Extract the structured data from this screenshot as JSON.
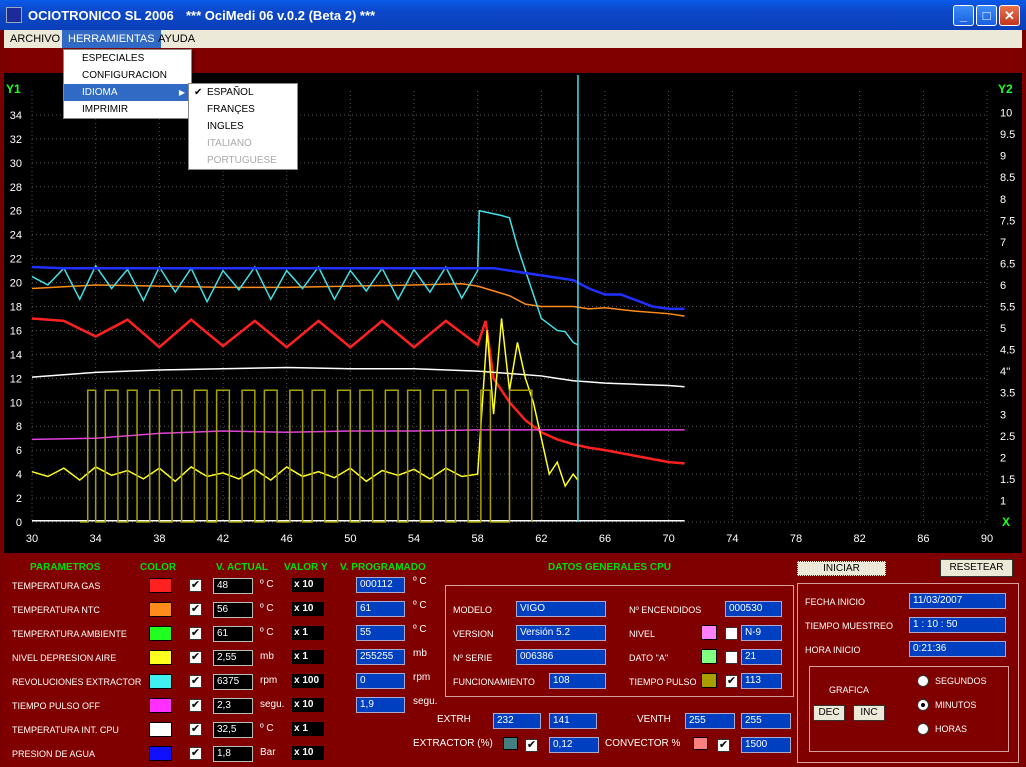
{
  "window": {
    "app_name": "OCIOTRONICO SL 2006",
    "title": "*** OciMedi 06  v.0.2 (Beta 2) ***",
    "minimize": "_",
    "maximize": "□",
    "close": "✕"
  },
  "menubar": [
    "ARCHIVO",
    "HERRAMIENTAS",
    "AYUDA"
  ],
  "herramientas_menu": [
    "ESPECIALES",
    "CONFIGURACION",
    "IDIOMA",
    "IMPRIMIR"
  ],
  "idioma_menu": {
    "items": [
      "ESPAÑOL",
      "FRANÇES",
      "INGLES",
      "ITALIANO",
      "PORTUGUESE"
    ],
    "selected": "ESPAÑOL",
    "disabled": [
      "ITALIANO",
      "PORTUGUESE"
    ]
  },
  "chart_data": {
    "type": "line",
    "y1_label": "Y1",
    "y2_label": "Y2",
    "x_label": "X",
    "xlim": [
      30,
      90
    ],
    "y1lim": [
      0,
      36
    ],
    "y2lim": [
      0.5,
      10.5
    ],
    "x_ticks": [
      "30",
      "34",
      "38",
      "42",
      "46",
      "50",
      "54",
      "58",
      "62",
      "66",
      "70",
      "74",
      "78",
      "82",
      "86",
      "90"
    ],
    "y1_ticks": [
      "0",
      "2",
      "4",
      "6",
      "8",
      "10",
      "12",
      "14",
      "16",
      "18",
      "20",
      "22",
      "24",
      "26",
      "28",
      "30",
      "32",
      "34"
    ],
    "y2_ticks": [
      "1",
      "1.5",
      "2",
      "2.5",
      "3",
      "3.5",
      "4''",
      "4.5",
      "5",
      "5.5",
      "6",
      "6.5",
      "7",
      "7.5",
      "8",
      "8.5",
      "9",
      "9.5",
      "10"
    ],
    "grid": true,
    "cursor_x": 64.3,
    "series": [
      {
        "name": "TEMPERATURA GAS",
        "color": "#ff2020",
        "x": [
          30,
          32,
          34,
          36,
          38,
          40,
          42,
          44,
          46,
          48,
          50,
          52,
          54,
          56,
          58,
          58.5,
          59,
          60,
          61,
          62,
          63,
          64,
          65,
          66,
          68,
          70,
          71
        ],
        "y": [
          17,
          16.8,
          15.5,
          16.9,
          14.6,
          16.9,
          14.7,
          16.8,
          14.6,
          16.8,
          14.6,
          16.8,
          14.6,
          16.8,
          14.8,
          16.8,
          12,
          10,
          8.5,
          7.5,
          6.9,
          6.5,
          6.2,
          6,
          5.5,
          5,
          4.9
        ]
      },
      {
        "name": "TEMPERATURA NTC",
        "color": "#ff8c1a",
        "x": [
          30,
          34,
          38,
          42,
          46,
          50,
          54,
          57,
          58,
          60,
          61,
          62,
          64,
          65,
          66,
          68,
          70,
          71
        ],
        "y": [
          19.5,
          19.8,
          19.7,
          19.6,
          19.6,
          19.7,
          19.8,
          19.9,
          19.7,
          18.9,
          18.2,
          18,
          18,
          17.8,
          17.9,
          17.6,
          17.4,
          17.2
        ]
      },
      {
        "name": "TEMPERATURA AMBIENTE",
        "color": "#ffffff",
        "x": [
          30,
          34,
          38,
          42,
          46,
          50,
          54,
          58,
          60,
          62,
          63,
          64,
          65,
          66,
          68,
          70,
          71
        ],
        "y": [
          12.1,
          12.5,
          12.7,
          12.8,
          12.9,
          12.8,
          12.8,
          12.6,
          12.4,
          12.2,
          12,
          11.8,
          11.7,
          11.6,
          11.5,
          11.4,
          11.3
        ]
      },
      {
        "name": "NIVEL DEPRESION AIRE",
        "color": "#ffff20",
        "x": [
          30,
          31,
          32,
          33,
          34,
          35,
          36,
          37,
          38,
          39,
          40,
          41,
          42,
          43,
          44,
          45,
          46,
          47,
          48,
          49,
          50,
          51,
          52,
          53,
          54,
          55,
          56,
          57,
          58,
          58.6,
          59,
          59.5,
          60,
          60.5,
          61,
          61.5,
          62,
          62.5,
          63,
          63.5,
          64,
          64.3
        ],
        "y": [
          4.2,
          3.8,
          4.5,
          3.5,
          4.6,
          3.9,
          4.3,
          3.6,
          4.5,
          3.4,
          4.6,
          3.8,
          4.1,
          3.6,
          4.4,
          3.5,
          4.6,
          3.8,
          4.2,
          3.7,
          4.5,
          3.4,
          4.3,
          3.9,
          4.4,
          3.6,
          4.5,
          3.8,
          4,
          16,
          9,
          17,
          11,
          15,
          12,
          10,
          7,
          4,
          5,
          3,
          4,
          3.5
        ]
      },
      {
        "name": "REVOLUCIONES EXTRACTOR",
        "color": "#40e0e8",
        "x": [
          30,
          31,
          32,
          33,
          34,
          35,
          36,
          37,
          38,
          39,
          40,
          41,
          42,
          43,
          44,
          45,
          46,
          47,
          48,
          49,
          50,
          51,
          52,
          53,
          54,
          55,
          56,
          57,
          58,
          58.1,
          59.5,
          60,
          60.5,
          61,
          61.5,
          62,
          62.5,
          63,
          63.5,
          64,
          64.3
        ],
        "y": [
          20.5,
          19.8,
          21.2,
          18.6,
          21.4,
          19.5,
          21.1,
          18.5,
          21.3,
          19.2,
          21.2,
          18.4,
          21,
          19.4,
          21.3,
          18.6,
          21,
          19.5,
          21.3,
          18.6,
          21,
          19.3,
          21.2,
          18.6,
          21.1,
          19.2,
          21.3,
          18.7,
          21,
          26,
          25.6,
          25.4,
          23,
          21,
          19,
          17,
          16.5,
          16,
          15.9,
          15,
          14.8
        ]
      },
      {
        "name": "TIEMPO PULSO OFF",
        "color": "#e040e0",
        "x": [
          30,
          34,
          38,
          42,
          46,
          50,
          54,
          58,
          60,
          62,
          64,
          66,
          68,
          70,
          71
        ],
        "y": [
          6.9,
          7,
          7.4,
          7.6,
          7.5,
          7.6,
          7.6,
          7.7,
          7.7,
          7.7,
          7.7,
          7.7,
          7.7,
          7.7,
          7.7
        ]
      },
      {
        "name": "TEMPERATURA INT. CPU",
        "color": "#ffffff",
        "x": [
          30,
          71
        ],
        "y": [
          0.1,
          0.1
        ]
      },
      {
        "name": "PRESION DE AGUA",
        "color": "#2030ff",
        "x": [
          30,
          32,
          34,
          36,
          38,
          40,
          42,
          44,
          46,
          48,
          50,
          52,
          54,
          56,
          58,
          59,
          61,
          62,
          63,
          64,
          65,
          66,
          67,
          68,
          69,
          70,
          71
        ],
        "y": [
          21.3,
          21.2,
          21.2,
          21.2,
          21.2,
          21.2,
          21.2,
          21.2,
          21.2,
          21.2,
          21.2,
          21.2,
          21.2,
          21.2,
          21.2,
          21.2,
          20.8,
          20.6,
          20.4,
          20.2,
          19.5,
          19,
          19,
          18.5,
          18,
          17.8,
          17.8
        ]
      },
      {
        "name": "TIEMPO PULSO",
        "color": "#a8a000",
        "x": [
          33,
          33.5,
          34,
          34.6,
          35.4,
          36,
          36.6,
          37.4,
          38,
          38.8,
          39.4,
          40.2,
          41,
          41.6,
          42.4,
          43.2,
          44,
          44.6,
          45.4,
          46.2,
          47,
          47.6,
          48.4,
          49.2,
          50,
          50.6,
          51.4,
          52.2,
          53,
          53.6,
          54.4,
          55.2,
          56,
          56.6,
          57.4,
          58.2,
          58.8,
          60,
          61.4
        ],
        "y": [
          0,
          11,
          0,
          11,
          0,
          11,
          0,
          11,
          0,
          11,
          0,
          11,
          0,
          11,
          0,
          11,
          0,
          11,
          0,
          11,
          0,
          11,
          0,
          11,
          0,
          11,
          0,
          11,
          0,
          11,
          0,
          11,
          0,
          11,
          0,
          11,
          0,
          11,
          0
        ]
      }
    ]
  },
  "parametros": {
    "headers": {
      "parametros": "PARAMETROS",
      "color": "COLOR",
      "v_actual": "V. ACTUAL",
      "valor_y": "VALOR Y",
      "v_programado": "V. PROGRAMADO"
    },
    "rows": [
      {
        "name": "TEMPERATURA GAS",
        "color": "#ff2020",
        "checked": true,
        "actual": "48",
        "unit": "º C",
        "mult": "x 10",
        "prog": "000112",
        "prog_unit": "º C"
      },
      {
        "name": "TEMPERATURA NTC",
        "color": "#ff8c1a",
        "checked": true,
        "actual": "56",
        "unit": "º C",
        "mult": "x 10",
        "prog": "61",
        "prog_unit": "º C"
      },
      {
        "name": "TEMPERATURA AMBIENTE",
        "color": "#20ff20",
        "checked": true,
        "actual": "61",
        "unit": "º C",
        "mult": "x 1",
        "prog": "55",
        "prog_unit": "º C"
      },
      {
        "name": "NIVEL DEPRESION AIRE",
        "color": "#ffff20",
        "checked": true,
        "actual": "2,55",
        "unit": "mb",
        "mult": "x 1",
        "prog": "255255",
        "prog_unit": "mb"
      },
      {
        "name": "REVOLUCIONES EXTRACTOR",
        "color": "#40f0f0",
        "checked": true,
        "actual": "6375",
        "unit": "rpm",
        "mult": "x 100",
        "prog": "0",
        "prog_unit": "rpm"
      },
      {
        "name": "TIEMPO PULSO OFF",
        "color": "#ff30ff",
        "checked": true,
        "actual": "2,3",
        "unit": "segu.",
        "mult": "x 10",
        "prog": "1,9",
        "prog_unit": "segu."
      },
      {
        "name": "TEMPERATURA INT. CPU",
        "color": "#ffffff",
        "checked": true,
        "actual": "32,5",
        "unit": "º C",
        "mult": "x 1",
        "prog": "",
        "prog_unit": ""
      },
      {
        "name": "PRESION DE AGUA",
        "color": "#1010ff",
        "checked": true,
        "actual": "1,8",
        "unit": "Bar",
        "mult": "x 10",
        "prog": "",
        "prog_unit": ""
      }
    ]
  },
  "datos_cpu": {
    "title": "DATOS GENERALES CPU",
    "modelo_label": "MODELO",
    "modelo": "VIGO",
    "version_label": "VERSION",
    "version": "Versión 5.2",
    "serie_label": "Nº SERIE",
    "serie": "006386",
    "funcionamiento_label": "FUNCIONAMIENTO",
    "funcionamiento": "108",
    "encendidos_label": "Nº ENCENDIDOS",
    "encendidos": "000530",
    "nivel_label": "NIVEL",
    "nivel_color": "#ff80ff",
    "nivel": "N-9",
    "dato_a_label": "DATO  \"A\"",
    "dato_a_color": "#80ff80",
    "dato_a": "21",
    "tiempo_pulso_label": "TIEMPO PULSO",
    "tiempo_pulso_color": "#a8a000",
    "tiempo_pulso": "113",
    "extrh_label": "EXTRH",
    "extrh_1": "232",
    "extrh_2": "141",
    "venth_label": "VENTH",
    "venth_1": "255",
    "venth_2": "255",
    "extractor_label": "EXTRACTOR (%)",
    "extractor_color": "#408080",
    "extractor": "0,12",
    "convector_label": "CONVECTOR %",
    "convector_color": "#ff8080",
    "convector": "1500"
  },
  "controls": {
    "iniciar": "INICIAR",
    "resetear": "RESETEAR",
    "fecha_inicio_label": "FECHA INICIO",
    "fecha_inicio": "11/03/2007",
    "tiempo_muestreo_label": "TIEMPO MUESTREO",
    "tiempo_muestreo": "1 : 10 : 50",
    "hora_inicio_label": "HORA INICIO",
    "hora_inicio": "0:21:36",
    "grafica_label": "GRAFICA",
    "dec": "DEC",
    "inc": "INC",
    "radios": [
      "SEGUNDOS",
      "MINUTOS",
      "HORAS"
    ],
    "radio_selected": "MINUTOS"
  }
}
